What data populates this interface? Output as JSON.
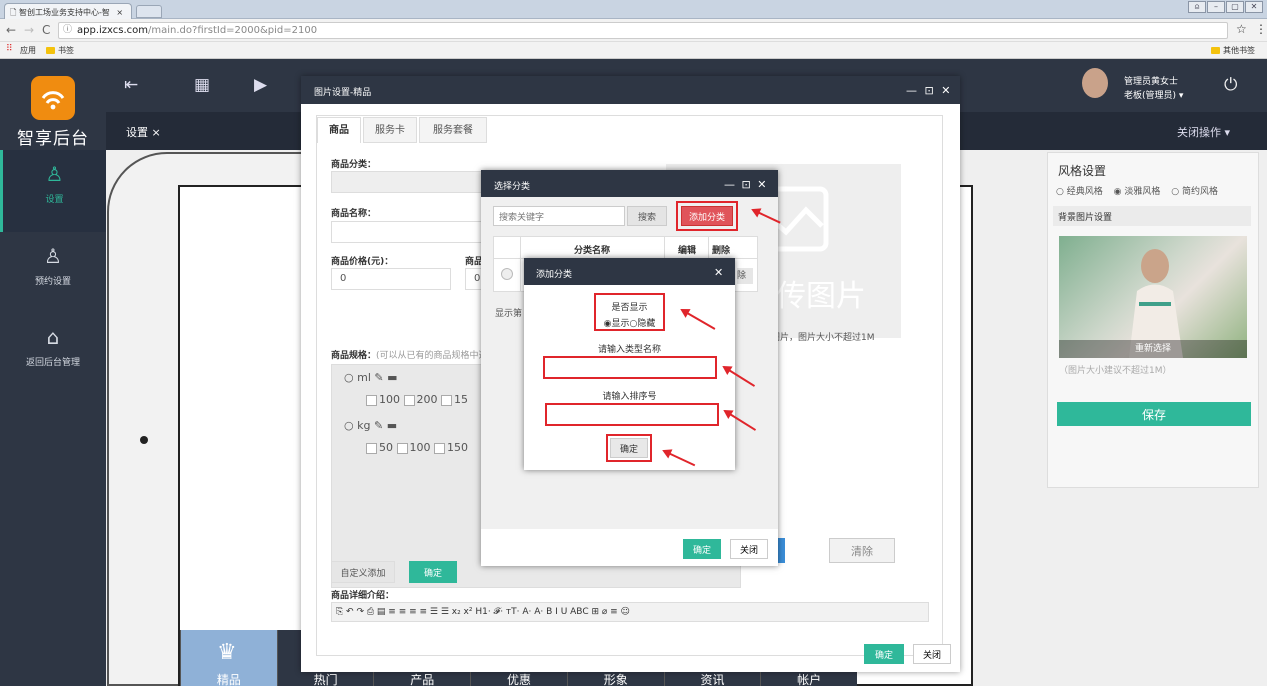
{
  "browser": {
    "tab_title": "智创工场业务支持中心-智",
    "tab_close": "×",
    "url_domain": "app.izxcs.com",
    "url_path": "/main.do?firstId=2000&pid=2100",
    "bookmarks_apps": "应用",
    "bookmarks_folder": "书签",
    "bookmarks_other": "其他书签"
  },
  "app": {
    "brand": "智享后台",
    "sidebar": [
      {
        "label": "设置"
      },
      {
        "label": "预约设置"
      },
      {
        "label": "返回后台管理"
      }
    ],
    "open_tab": "设置 ×",
    "close_ops": "关闭操作 ▾",
    "user_name": "管理员黄女士",
    "user_role": "老板(管理员) ▾"
  },
  "right_panel": {
    "style_title": "风格设置",
    "styles": [
      "经典风格",
      "淡雅风格",
      "简约风格"
    ],
    "bg_title": "背景图片设置",
    "reselect": "重新选择",
    "note": "（图片大小建议不超过1M）",
    "save": "保存"
  },
  "phone": {
    "nav": [
      "精品",
      "热门",
      "产品",
      "优惠",
      "形象",
      "资讯",
      "帐户"
    ]
  },
  "dialog_image": {
    "title": "图片设置-精品",
    "tabs": [
      "商品",
      "服务卡",
      "服务套餐"
    ],
    "category_label": "商品分类：",
    "name_label": "商品名称：",
    "price_label": "商品价格(元)：",
    "price_value": "0",
    "price2_label": "商品",
    "price2_value": "0",
    "spec_label": "商品规格：",
    "spec_hint": "(可以从已有的商品规格中选",
    "spec_groups": [
      {
        "name": "ml",
        "options": [
          "100",
          "200",
          "15"
        ]
      },
      {
        "name": "kg",
        "options": [
          "50",
          "100",
          "150"
        ]
      }
    ],
    "img_text": "传图片",
    "img_note": "图片，图片大小不超过1M",
    "custom_add": "自定义添加",
    "confirm": "确定",
    "clear": "清除",
    "detail_label": "商品详细介绍：",
    "editor_toolbar": "⎘ ↶ ↷ ⎙ ▤ ≡ ≡ ≡ ≡ ☰ ☰ x₂ x² H1· 𝓕· тT· A· A· B I U ABC ⊞ ⌀ ≡ ☺",
    "ok": "确定",
    "close": "关闭"
  },
  "dialog_select": {
    "title": "选择分类",
    "search_placeholder": "搜索关键字",
    "search": "搜索",
    "add": "添加分类",
    "col_name": "分类名称",
    "col_edit": "编辑",
    "col_delete": "删除",
    "row_delete": "除",
    "show_label": "显示第",
    "ok": "确定",
    "close": "关闭"
  },
  "dialog_add": {
    "title": "添加分类",
    "show_label": "是否显示",
    "show_opt": "显示",
    "hide_opt": "隐藏",
    "type_name_label": "请输入类型名称",
    "order_label": "请输入排序号",
    "ok": "确定"
  },
  "colors": {
    "accent": "#2fb89a",
    "dark": "#2e3644",
    "red": "#e0252b",
    "orange": "#f08c10"
  }
}
